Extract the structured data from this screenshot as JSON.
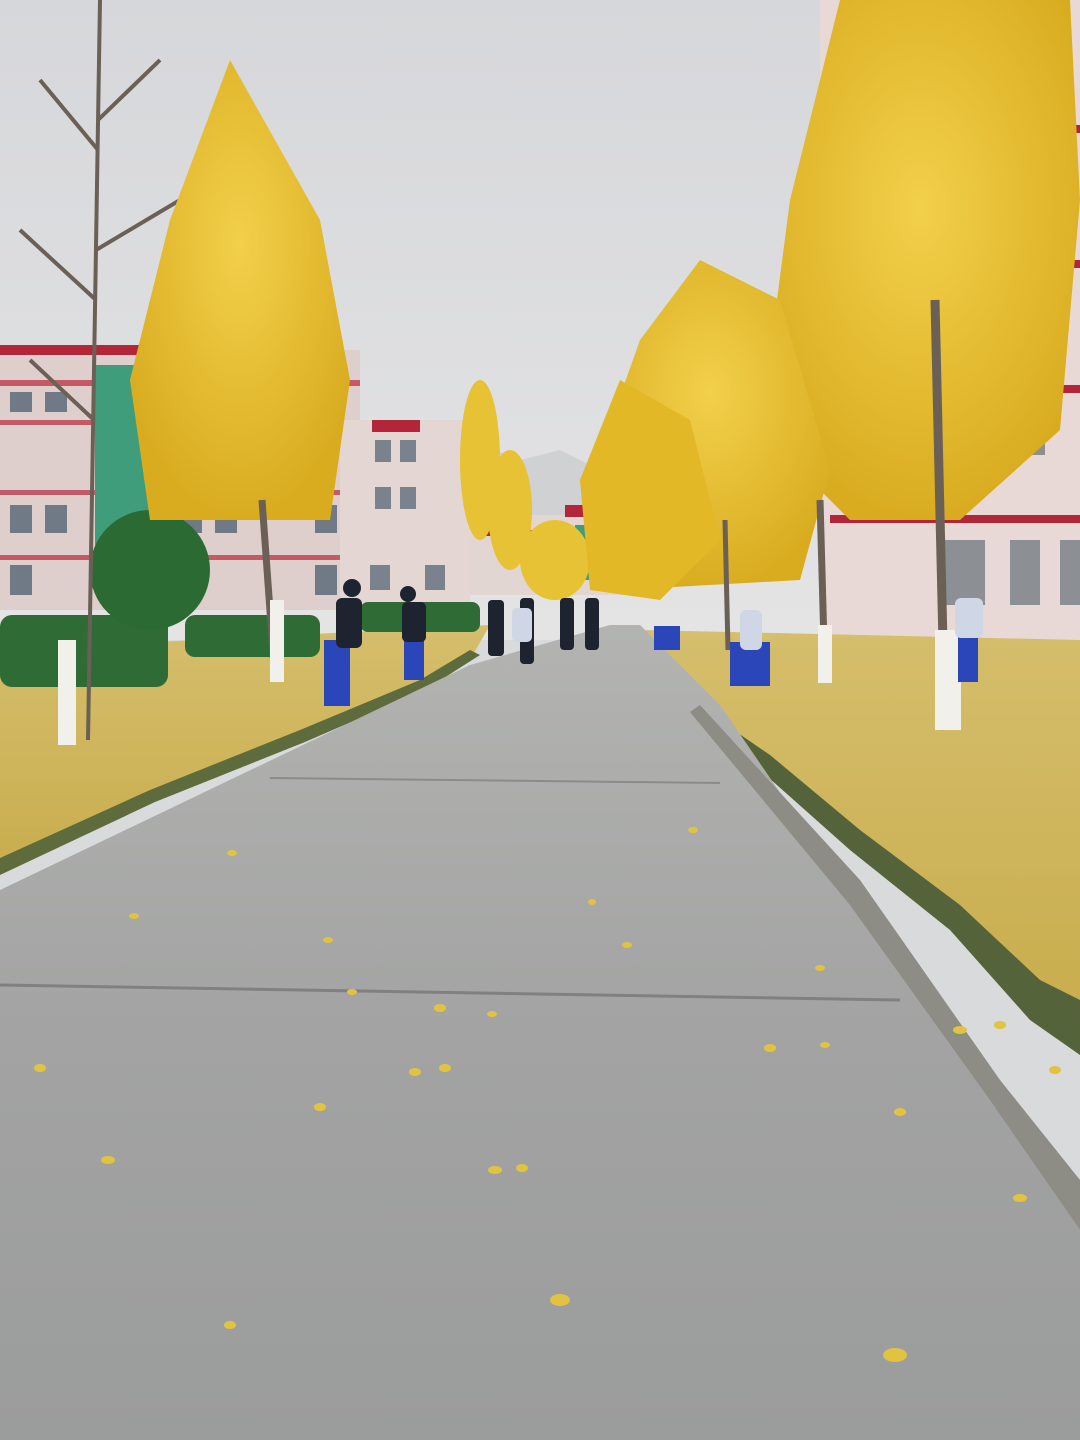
{
  "scene": {
    "subject": "campus-walkway-with-ginkgo-trees",
    "season": "autumn",
    "colors": {
      "sky": "#dcdde0",
      "pavement": "#a3a4a3",
      "pavement_light": "#b4b5b3",
      "lawn_leaves": "#d8bf63",
      "foliage": "#e9c233",
      "foliage_dark": "#c9a220",
      "building_left": "#dfcfcc",
      "building_right": "#e8d9d6",
      "window_stripe": "#b3263a",
      "glass_green": "#3f9d7b",
      "uniform_blue": "#2a46b8",
      "hedge": "#2f6b34",
      "trunk_white": "#f2f0ea"
    }
  }
}
